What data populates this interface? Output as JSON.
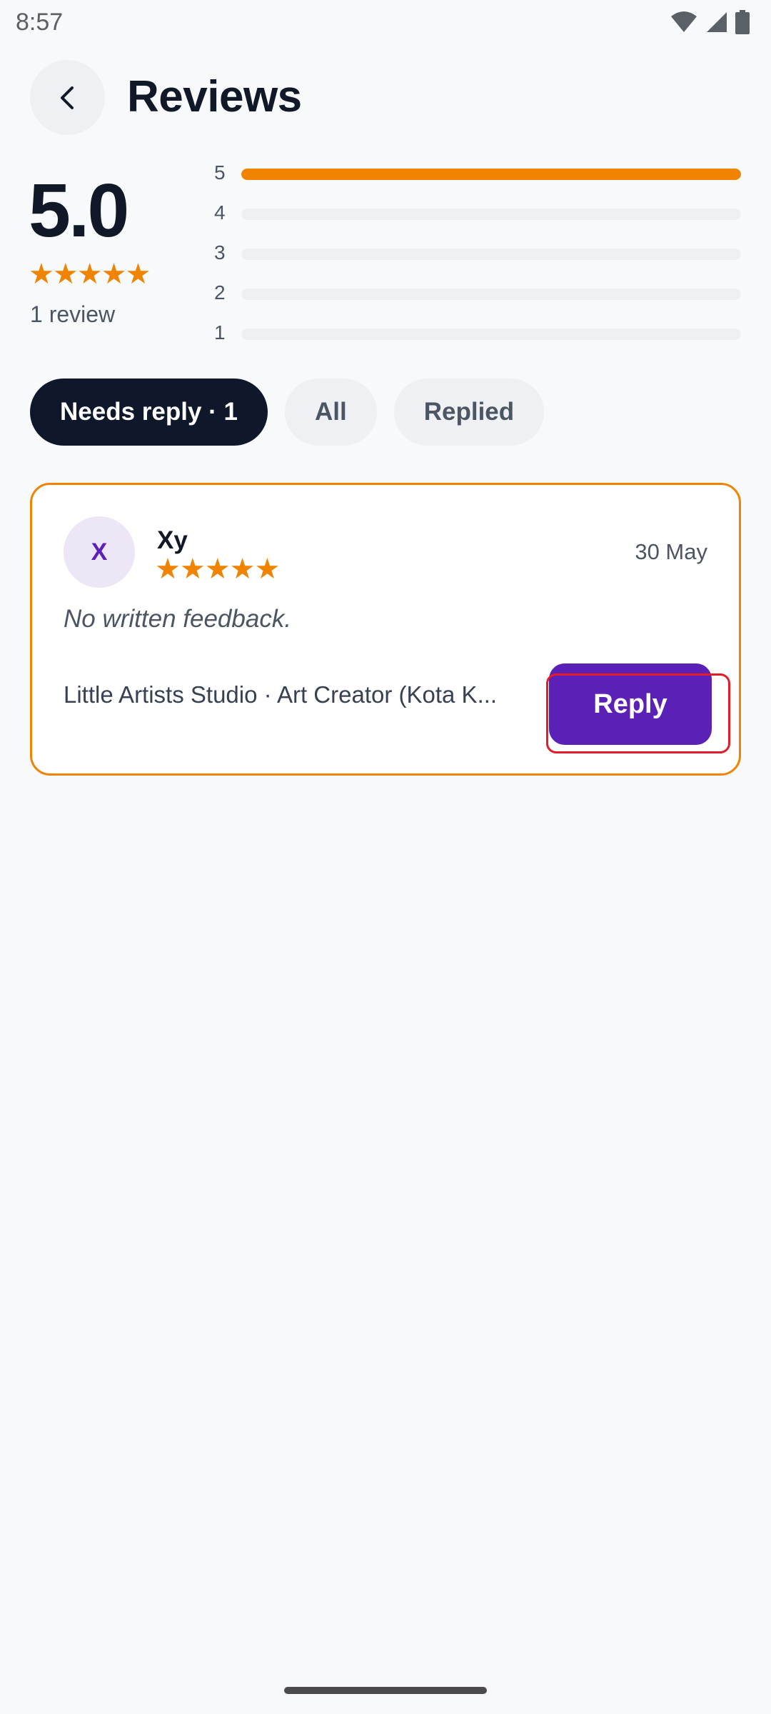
{
  "status_bar": {
    "time": "8:57",
    "icons": [
      "wifi-icon",
      "signal-icon",
      "battery-icon"
    ]
  },
  "header": {
    "back_icon": "chevron-left-icon",
    "title": "Reviews"
  },
  "summary": {
    "score": "5.0",
    "stars": "★★★★★",
    "count_text": "1 review",
    "distribution": [
      {
        "label": "5",
        "fraction": 1.0
      },
      {
        "label": "4",
        "fraction": 0.0
      },
      {
        "label": "3",
        "fraction": 0.0
      },
      {
        "label": "2",
        "fraction": 0.0
      },
      {
        "label": "1",
        "fraction": 0.0
      }
    ]
  },
  "filters": {
    "chips": [
      {
        "label": "Needs reply · 1",
        "active": true
      },
      {
        "label": "All",
        "active": false
      },
      {
        "label": "Replied",
        "active": false
      }
    ]
  },
  "reviews": [
    {
      "avatar_letter": "X",
      "name": "Xy",
      "stars": "★★★★★",
      "date": "30 May",
      "feedback": "No written feedback.",
      "listing": "Little Artists Studio · Art Creator (Kota K...",
      "reply_label": "Reply"
    }
  ],
  "colors": {
    "accent_orange": "#f08300",
    "primary_purple": "#5b21b6",
    "dark_chip": "#0f172a",
    "highlight_red": "#e11d2a"
  }
}
